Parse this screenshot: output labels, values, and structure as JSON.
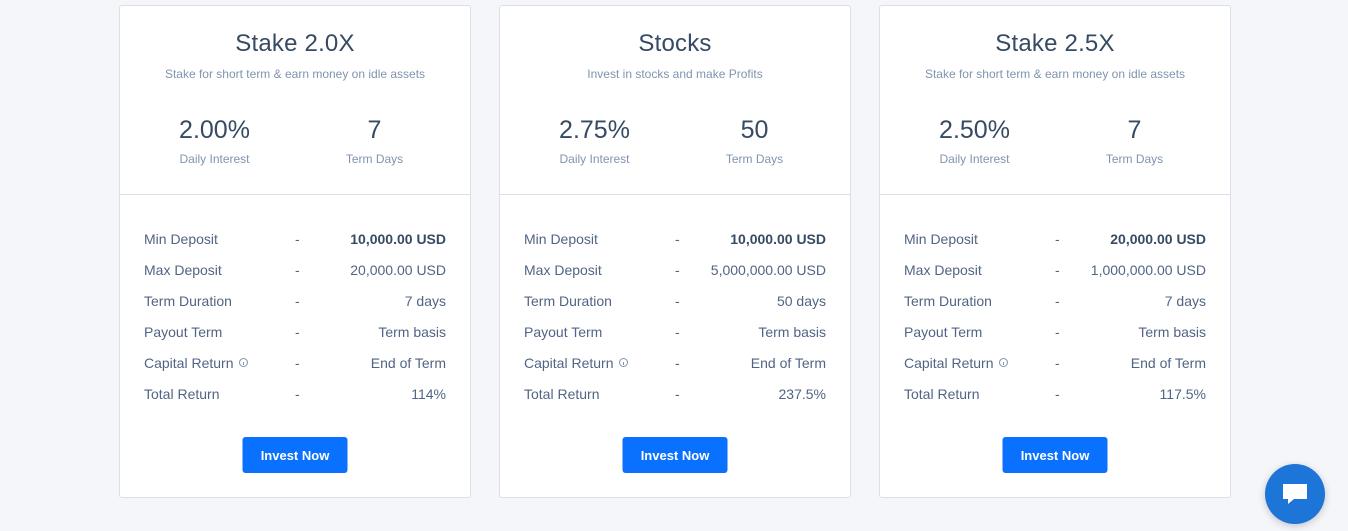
{
  "plans": [
    {
      "title": "Stake 2.0X",
      "subtitle": "Stake for short term & earn money on idle assets",
      "interest": "2.00%",
      "interest_label": "Daily Interest",
      "term": "7",
      "term_label": "Term Days",
      "details": [
        {
          "label": "Min Deposit",
          "sep": "-",
          "value": "10,000.00 USD"
        },
        {
          "label": "Max Deposit",
          "sep": "-",
          "value": "20,000.00 USD"
        },
        {
          "label": "Term Duration",
          "sep": "-",
          "value": "7 days"
        },
        {
          "label": "Payout Term",
          "sep": "-",
          "value": "Term basis"
        },
        {
          "label": "Capital Return",
          "sep": "-",
          "value": "End of Term"
        },
        {
          "label": "Total Return",
          "sep": "-",
          "value": "114%"
        }
      ],
      "button": "Invest Now"
    },
    {
      "title": "Stocks",
      "subtitle": "Invest in stocks and make Profits",
      "interest": "2.75%",
      "interest_label": "Daily Interest",
      "term": "50",
      "term_label": "Term Days",
      "details": [
        {
          "label": "Min Deposit",
          "sep": "-",
          "value": "10,000.00 USD"
        },
        {
          "label": "Max Deposit",
          "sep": "-",
          "value": "5,000,000.00 USD"
        },
        {
          "label": "Term Duration",
          "sep": "-",
          "value": "50 days"
        },
        {
          "label": "Payout Term",
          "sep": "-",
          "value": "Term basis"
        },
        {
          "label": "Capital Return",
          "sep": "-",
          "value": "End of Term"
        },
        {
          "label": "Total Return",
          "sep": "-",
          "value": "237.5%"
        }
      ],
      "button": "Invest Now"
    },
    {
      "title": "Stake 2.5X",
      "subtitle": "Stake for short term & earn money on idle assets",
      "interest": "2.50%",
      "interest_label": "Daily Interest",
      "term": "7",
      "term_label": "Term Days",
      "details": [
        {
          "label": "Min Deposit",
          "sep": "-",
          "value": "20,000.00 USD"
        },
        {
          "label": "Max Deposit",
          "sep": "-",
          "value": "1,000,000.00 USD"
        },
        {
          "label": "Term Duration",
          "sep": "-",
          "value": "7 days"
        },
        {
          "label": "Payout Term",
          "sep": "-",
          "value": "Term basis"
        },
        {
          "label": "Capital Return",
          "sep": "-",
          "value": "End of Term"
        },
        {
          "label": "Total Return",
          "sep": "-",
          "value": "117.5%"
        }
      ],
      "button": "Invest Now"
    }
  ],
  "icons": {
    "info": "info-circle-icon",
    "chat": "chat-bubble-icon"
  },
  "colors": {
    "accent": "#0971fe",
    "chat": "#1d75d8"
  }
}
